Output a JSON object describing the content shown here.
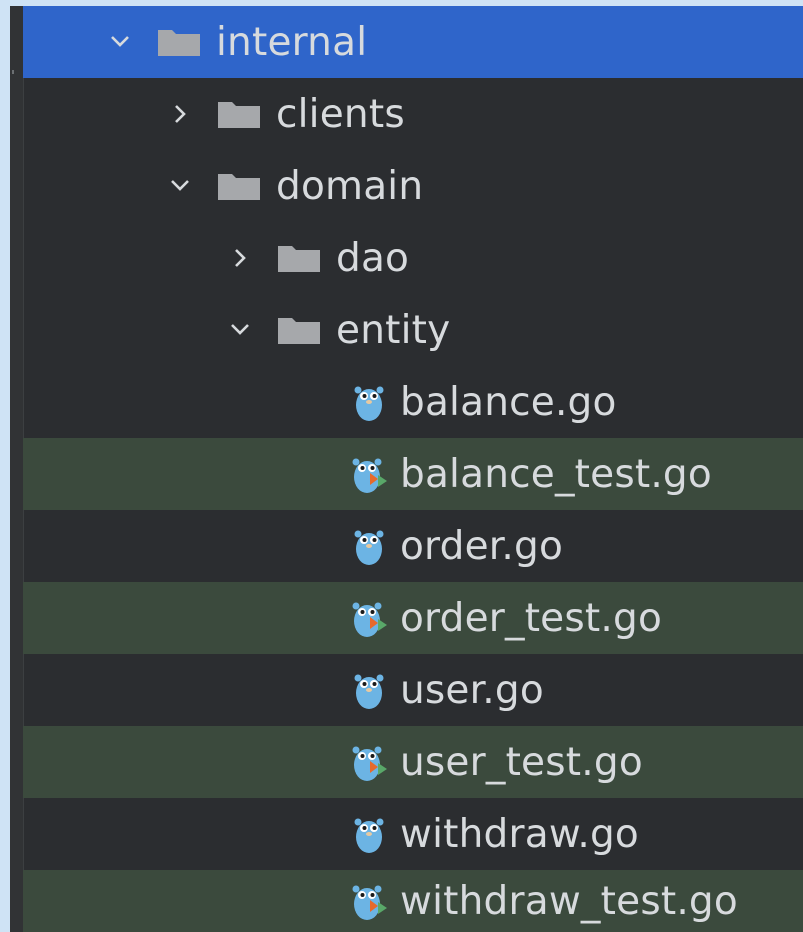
{
  "tree": {
    "root": {
      "label": "internal",
      "expanded": true
    },
    "clients": {
      "label": "clients",
      "expanded": false
    },
    "domain": {
      "label": "domain",
      "expanded": true
    },
    "dao": {
      "label": "dao",
      "expanded": false
    },
    "entity": {
      "label": "entity",
      "expanded": true
    },
    "files": [
      {
        "label": "balance.go",
        "type": "go"
      },
      {
        "label": "balance_test.go",
        "type": "go-test"
      },
      {
        "label": "order.go",
        "type": "go"
      },
      {
        "label": "order_test.go",
        "type": "go-test"
      },
      {
        "label": "user.go",
        "type": "go"
      },
      {
        "label": "user_test.go",
        "type": "go-test"
      },
      {
        "label": "withdraw.go",
        "type": "go"
      },
      {
        "label": "withdraw_test.go",
        "type": "go-test"
      }
    ]
  },
  "icons": {
    "chevron_expanded": "chevron-down-icon",
    "chevron_collapsed": "chevron-right-icon",
    "folder": "folder-icon",
    "go_file": "go-gopher-icon",
    "go_test_file": "go-test-gopher-icon"
  },
  "colors": {
    "panel_bg": "#2b2d30",
    "selection": "#2f65ca",
    "test_row": "#3b4a3d",
    "text": "#d7dadd",
    "folder": "#a6a8ab",
    "gopher": "#6cb4e4",
    "test_arrow": "#59a869"
  }
}
